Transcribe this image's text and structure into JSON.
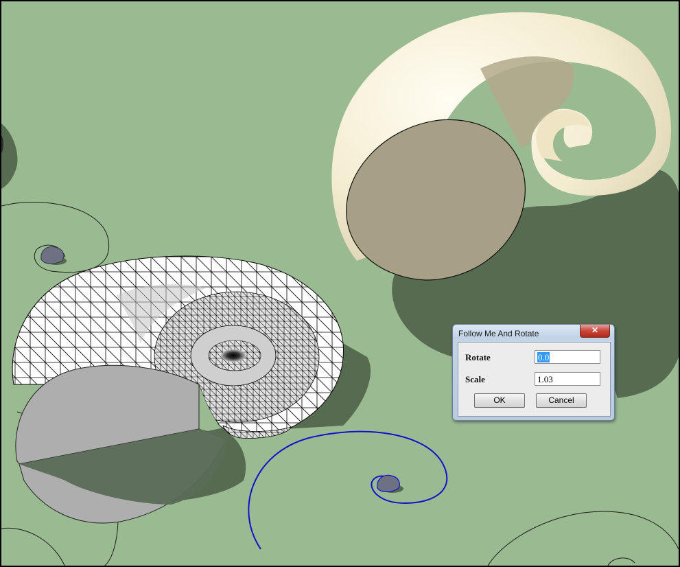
{
  "dialog": {
    "title": "Follow Me And Rotate",
    "close_glyph": "✕",
    "rotate_label": "Rotate",
    "rotate_value": "0.0",
    "scale_label": "Scale",
    "scale_value": "1.03",
    "ok_label": "OK",
    "cancel_label": "Cancel"
  },
  "colors": {
    "ground": "#9aba91",
    "shadow": "#576b51",
    "shell_cream": "#f6efd3",
    "shell_section": "#a89f87",
    "wire_face": "#ffffff",
    "wire_section": "#aeaeae",
    "path_selected": "#1111cc",
    "profile_disc": "#6e7184"
  }
}
